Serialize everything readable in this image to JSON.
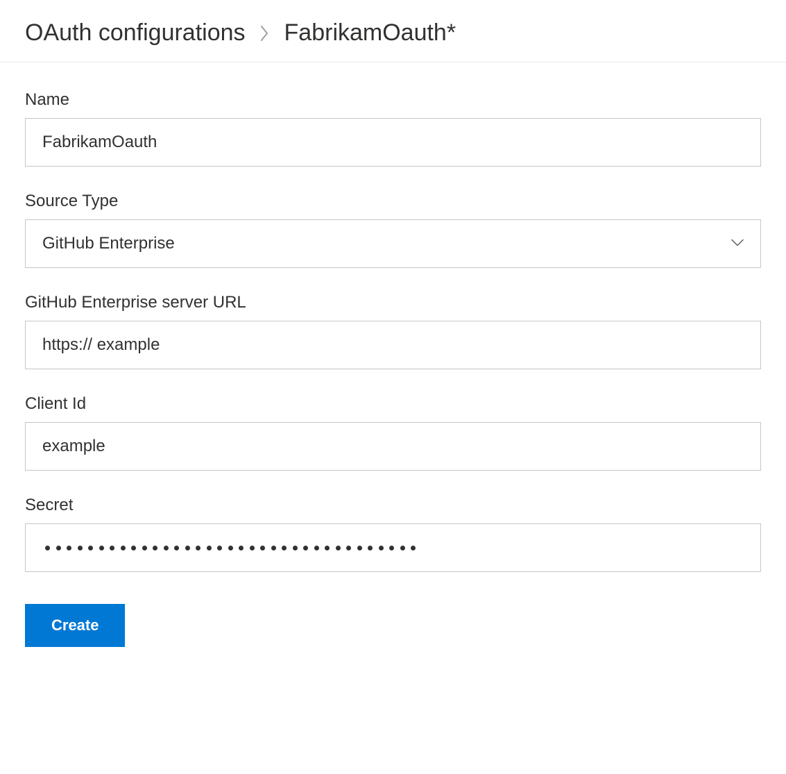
{
  "breadcrumb": {
    "parent": "OAuth configurations",
    "current": "FabrikamOauth*"
  },
  "form": {
    "name": {
      "label": "Name",
      "value": "FabrikamOauth"
    },
    "source_type": {
      "label": "Source Type",
      "value": "GitHub Enterprise"
    },
    "server_url": {
      "label": "GitHub Enterprise server URL",
      "value": "https:// example"
    },
    "client_id": {
      "label": "Client Id",
      "value": "example"
    },
    "secret": {
      "label": "Secret",
      "dot_count": 35
    }
  },
  "actions": {
    "create_label": "Create"
  }
}
